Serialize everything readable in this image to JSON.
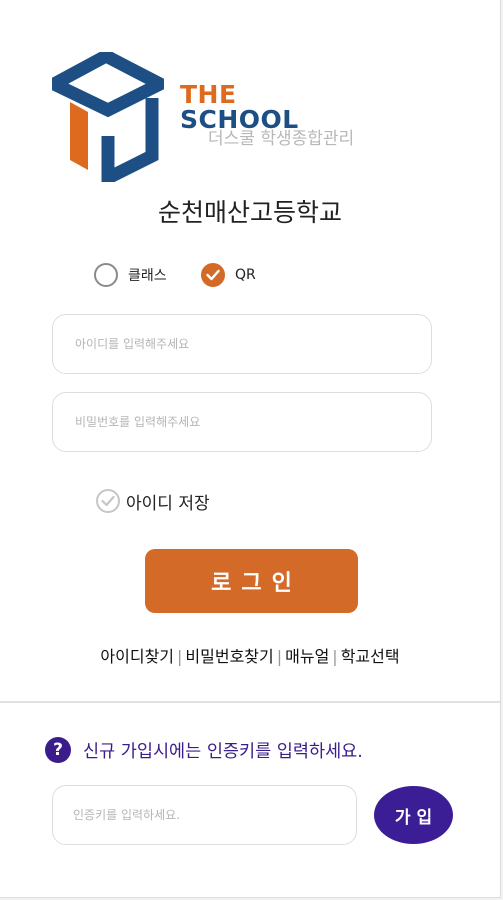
{
  "logo": {
    "word1": "THE",
    "word2": "SCHOOL",
    "subtitle": "더스쿨 학생종합관리"
  },
  "school_name": "순천매산고등학교",
  "login_type": {
    "options": [
      {
        "label": "클래스",
        "checked": false
      },
      {
        "label": "QR",
        "checked": true
      }
    ]
  },
  "form": {
    "id_placeholder": "아이디를 입력해주세요",
    "password_placeholder": "비밀번호를 입력해주세요",
    "save_id_label": "아이디 저장",
    "login_button": "로그인"
  },
  "links": {
    "find_id": "아이디찾기",
    "find_password": "비밀번호찾기",
    "manual": "매뉴얼",
    "select_school": "학교선택",
    "separator": "|"
  },
  "signup": {
    "notice_icon": "question-circle-icon",
    "notice_icon_glyph": "?",
    "notice": "신규 가입시에는 인증키를 입력하세요.",
    "auth_placeholder": "인증키를 입력하세요.",
    "join_button": "가입"
  },
  "colors": {
    "accent_orange": "#d46a28",
    "logo_blue": "#1d4f85",
    "signup_purple": "#3a1d8a"
  }
}
